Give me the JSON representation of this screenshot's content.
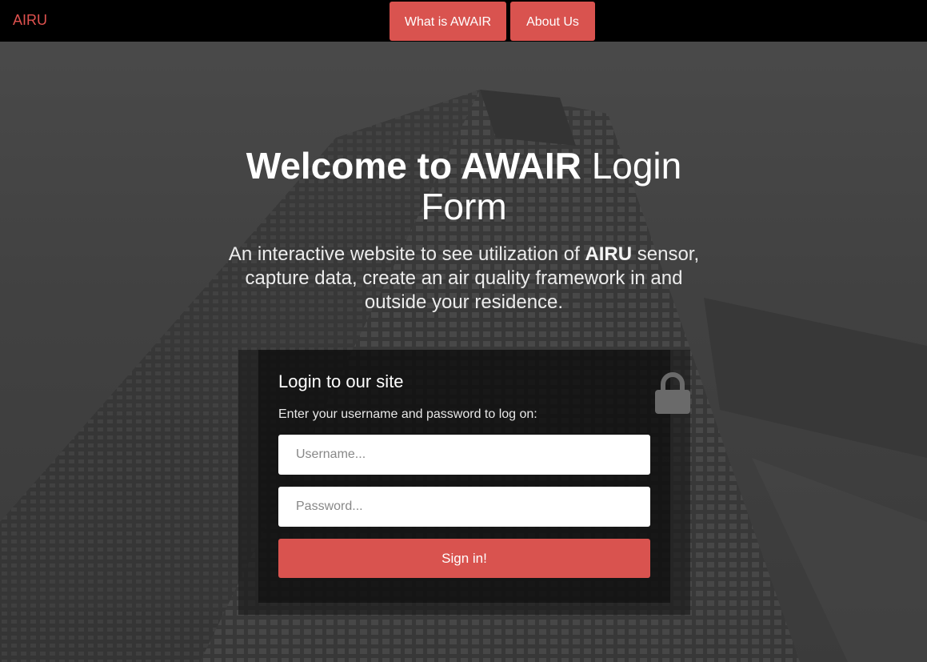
{
  "navbar": {
    "brand": "AIRU",
    "links": [
      {
        "label": "What is AWAIR"
      },
      {
        "label": "About Us"
      }
    ]
  },
  "hero": {
    "title_bold": "Welcome to AWAIR",
    "title_rest": "Login Form",
    "subtitle_pre": "An interactive website to see utilization of",
    "subtitle_bold": "AIRU",
    "subtitle_post": "sensor, capture data, create an air quality framework in and outside your residence."
  },
  "login": {
    "title": "Login to our site",
    "description": "Enter your username and password to log on:",
    "username_placeholder": "Username...",
    "password_placeholder": "Password...",
    "submit_label": "Sign in!",
    "icon": "lock-icon"
  },
  "colors": {
    "accent": "#d9534f",
    "brand": "#e0524f",
    "navbar": "#000000"
  }
}
